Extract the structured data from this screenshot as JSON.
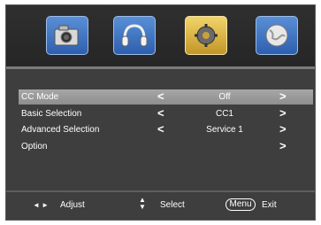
{
  "tabs": [
    {
      "id": "picture",
      "icon": "camera-icon",
      "active": false
    },
    {
      "id": "sound",
      "icon": "headphones-icon",
      "active": false
    },
    {
      "id": "setup",
      "icon": "gear-icon",
      "active": true
    },
    {
      "id": "globe",
      "icon": "globe-icon",
      "active": false
    }
  ],
  "menu": {
    "rows": [
      {
        "label": "CC  Mode",
        "value": "Off",
        "left_arrow": "<",
        "right_arrow": ">",
        "selected": true
      },
      {
        "label": "Basic Selection",
        "value": "CC1",
        "left_arrow": "<",
        "right_arrow": ">",
        "selected": false
      },
      {
        "label": "Advanced Selection",
        "value": "Service 1",
        "left_arrow": "<",
        "right_arrow": ">",
        "selected": false
      },
      {
        "label": "Option",
        "value": "",
        "left_arrow": "",
        "right_arrow": ">",
        "selected": false
      }
    ]
  },
  "footer": {
    "adjust_icon": "◄ ►",
    "adjust_label": "Adjust",
    "select_icon": "▲▼",
    "select_label": "Select",
    "menu_key": "Menu",
    "exit_label": "Exit"
  },
  "colors": {
    "panel": "#3e3e3e",
    "selected_row": "#9a9a9a",
    "tab_blue": "#3d6fbf",
    "tab_gold": "#d7aa3c"
  }
}
